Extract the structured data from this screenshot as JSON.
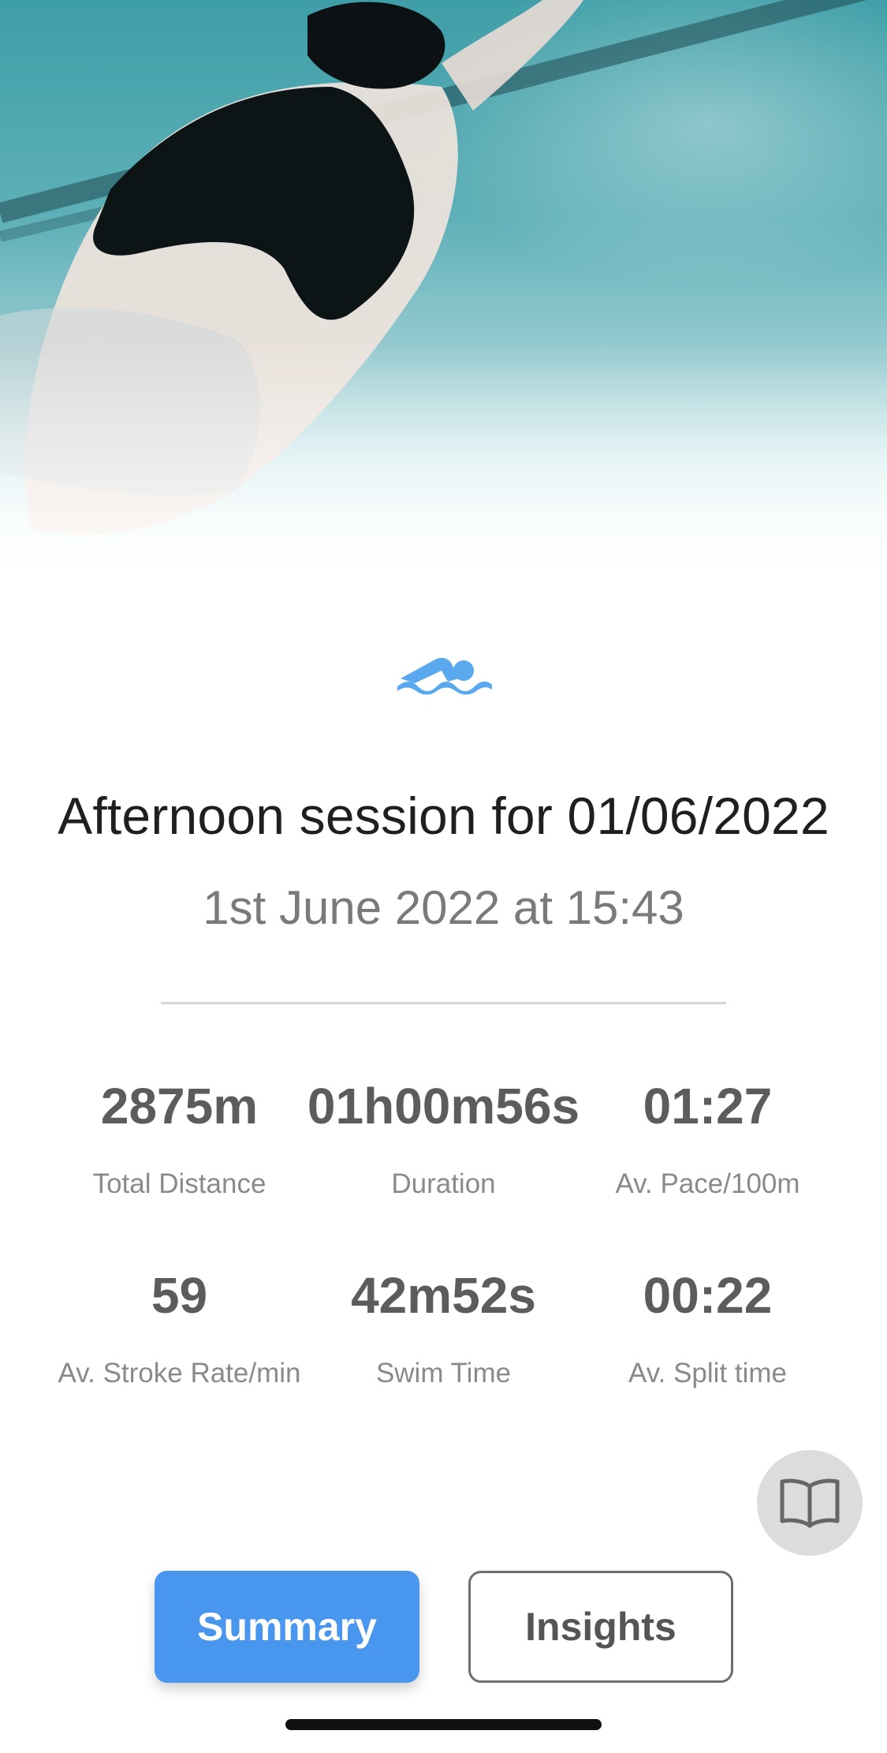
{
  "session": {
    "title": "Afternoon session for 01/06/2022",
    "datetime": "1st June 2022 at 15:43"
  },
  "stats": [
    {
      "value": "2875m",
      "label": "Total Distance"
    },
    {
      "value": "01h00m56s",
      "label": "Duration"
    },
    {
      "value": "01:27",
      "label": "Av. Pace/100m"
    },
    {
      "value": "59",
      "label": "Av. Stroke Rate/min"
    },
    {
      "value": "42m52s",
      "label": "Swim Time"
    },
    {
      "value": "00:22",
      "label": "Av. Split time"
    }
  ],
  "buttons": {
    "summary": "Summary",
    "insights": "Insights"
  },
  "icons": {
    "activity": "swimmer-icon",
    "guide": "book-icon"
  },
  "colors": {
    "accent": "#4996ef",
    "swim_icon": "#5aa8ee"
  }
}
